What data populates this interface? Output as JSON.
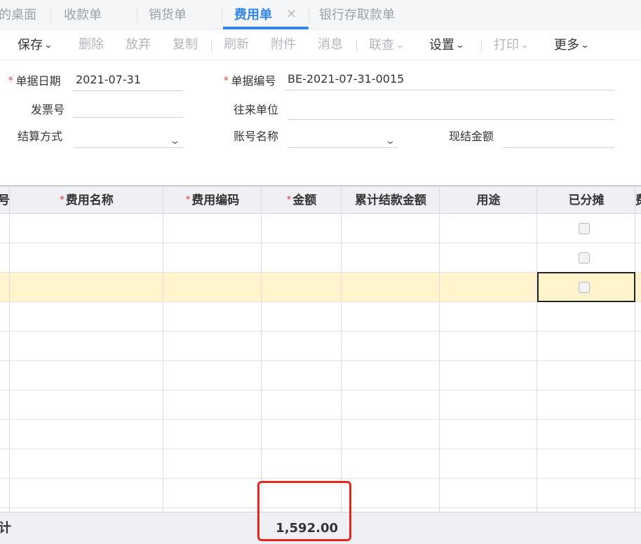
{
  "tabs": [
    {
      "label": "的桌面"
    },
    {
      "label": "收款单"
    },
    {
      "label": "销货单"
    },
    {
      "label": "费用单",
      "close": "✕"
    },
    {
      "label": "银行存取款单"
    }
  ],
  "toolbar": {
    "save": "保存",
    "delete": "删除",
    "discard": "放弃",
    "copy": "复制",
    "refresh": "刷新",
    "attach": "附件",
    "message": "消息",
    "link": "联查",
    "settings": "设置",
    "print": "打印",
    "more": "更多"
  },
  "form": {
    "date_label": "单据日期",
    "date_value": "2021-07-31",
    "number_label": "单据编号",
    "number_value": "BE-2021-07-31-0015",
    "invoice_label": "发票号",
    "invoice_value": "",
    "partner_label": "往来单位",
    "partner_value": "",
    "settle_label": "结算方式",
    "settle_value": "",
    "account_label": "账号名称",
    "account_value": "",
    "cash_label": "现结金额",
    "cash_value": ""
  },
  "grid": {
    "headers": {
      "no": "号",
      "name": "费用名称",
      "code": "费用编码",
      "amount": "金额",
      "settled": "累计结款金额",
      "purpose": "用途",
      "allocated": "已分摊",
      "extra": "费"
    },
    "total_label": "计",
    "total_amount": "1,592.00"
  },
  "colors": {
    "accent": "#2f86e8",
    "required": "#e5312c",
    "highlight_row": "#fff4cc",
    "annotation": "#e8261e"
  }
}
